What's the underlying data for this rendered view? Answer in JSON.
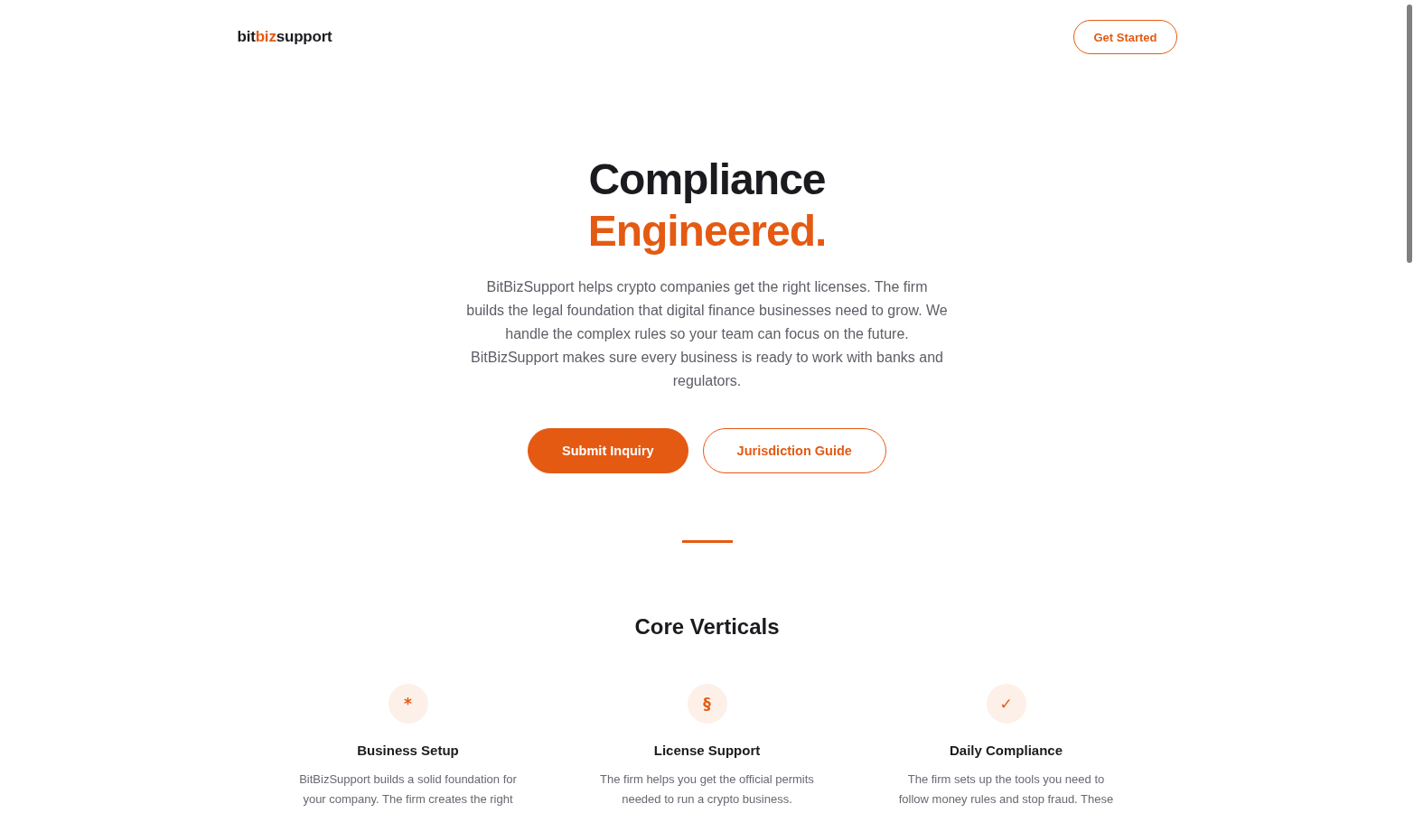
{
  "header": {
    "logo": [
      {
        "text": "bit",
        "accent": false
      },
      {
        "text": "biz",
        "accent": true
      },
      {
        "text": "support",
        "accent": false
      }
    ],
    "cta": {
      "label": "Get Started",
      "kind": "outline"
    }
  },
  "hero": {
    "title_lines": [
      {
        "text": "Compliance",
        "accent": false
      },
      {
        "text": "Engineered.",
        "accent": true
      }
    ],
    "description_lines": [
      "BitBizSupport helps crypto companies get the right licenses. The firm",
      "builds the legal foundation that digital finance businesses need to grow. We",
      "handle the complex rules so your team can focus on the future.",
      "BitBizSupport makes sure every business is ready to work with banks and",
      "regulators."
    ],
    "buttons": [
      {
        "label": "Submit Inquiry",
        "kind": "primary"
      },
      {
        "label": "Jurisdiction Guide",
        "kind": "outline"
      }
    ]
  },
  "core_verticals": {
    "title": "Core Verticals",
    "items": [
      {
        "icon": "*",
        "title": "Business Setup",
        "description_lines": [
          "BitBizSupport builds a solid foundation for",
          "your company. The firm creates the right"
        ]
      },
      {
        "icon": "§",
        "title": "License Support",
        "description_lines": [
          "The firm helps you get the official permits",
          "needed to run a crypto business."
        ]
      },
      {
        "icon": "✓",
        "title": "Daily Compliance",
        "description_lines": [
          "The firm sets up the tools you need to",
          "follow money rules and stop fraud. These"
        ]
      }
    ]
  }
}
